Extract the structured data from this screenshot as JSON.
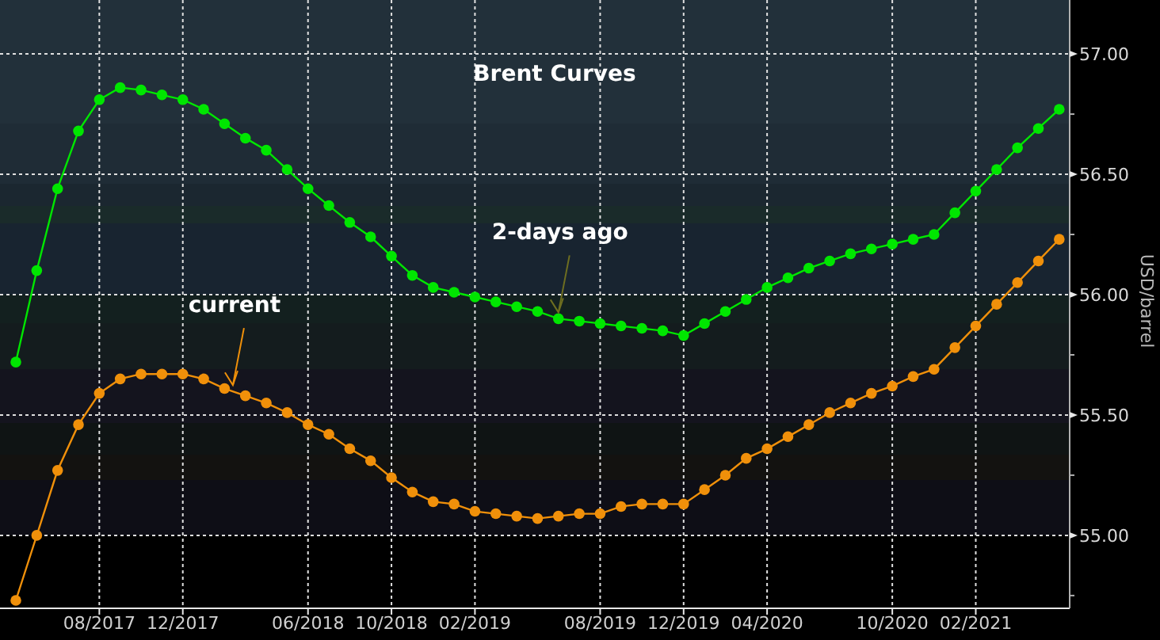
{
  "chart_data": {
    "type": "line",
    "title": "Brent Curves",
    "ylabel": "USD/barrel",
    "categories": [
      null,
      null,
      null,
      null,
      "08/2017",
      null,
      null,
      null,
      "12/2017",
      null,
      null,
      null,
      null,
      null,
      "06/2018",
      null,
      null,
      null,
      "10/2018",
      null,
      null,
      null,
      "02/2019",
      null,
      null,
      null,
      null,
      null,
      "08/2019",
      null,
      null,
      null,
      "12/2019",
      null,
      null,
      null,
      "04/2020",
      null,
      null,
      null,
      null,
      null,
      "10/2020",
      null,
      null,
      null,
      "02/2021",
      null,
      null,
      null,
      null
    ],
    "series": [
      {
        "name": "2-days ago",
        "marker": "o",
        "color": "#00e600",
        "values": [
          55.72,
          56.1,
          56.44,
          56.68,
          56.81,
          56.86,
          56.85,
          56.83,
          56.81,
          56.77,
          56.71,
          56.65,
          56.6,
          56.52,
          56.44,
          56.37,
          56.3,
          56.24,
          56.16,
          56.08,
          56.03,
          56.01,
          55.99,
          55.97,
          55.95,
          55.93,
          55.9,
          55.89,
          55.88,
          55.87,
          55.86,
          55.85,
          55.83,
          55.88,
          55.93,
          55.98,
          56.03,
          56.07,
          56.11,
          56.14,
          56.17,
          56.19,
          56.21,
          56.23,
          56.25,
          56.34,
          56.43,
          56.52,
          56.61,
          56.69,
          56.77
        ]
      },
      {
        "name": "current",
        "marker": "o",
        "color": "#f0900a",
        "values": [
          54.73,
          55.0,
          55.27,
          55.46,
          55.59,
          55.65,
          55.67,
          55.67,
          55.67,
          55.65,
          55.61,
          55.58,
          55.55,
          55.51,
          55.46,
          55.42,
          55.36,
          55.31,
          55.24,
          55.18,
          55.14,
          55.13,
          55.1,
          55.09,
          55.08,
          55.07,
          55.08,
          55.09,
          55.09,
          55.12,
          55.13,
          55.13,
          55.13,
          55.19,
          55.25,
          55.32,
          55.36,
          55.41,
          55.46,
          55.51,
          55.55,
          55.59,
          55.62,
          55.66,
          55.69,
          55.78,
          55.87,
          55.96,
          56.05,
          56.14,
          56.23
        ]
      }
    ],
    "grid": true,
    "ylim": [
      54.697,
      57.224
    ],
    "yticks": [
      {
        "value": 55,
        "label": "55.00"
      },
      {
        "value": 55.5,
        "label": "55.50"
      },
      {
        "value": 56,
        "label": "56.00"
      },
      {
        "value": 56.5,
        "label": "56.50"
      },
      {
        "value": 57,
        "label": "57.00"
      }
    ]
  }
}
